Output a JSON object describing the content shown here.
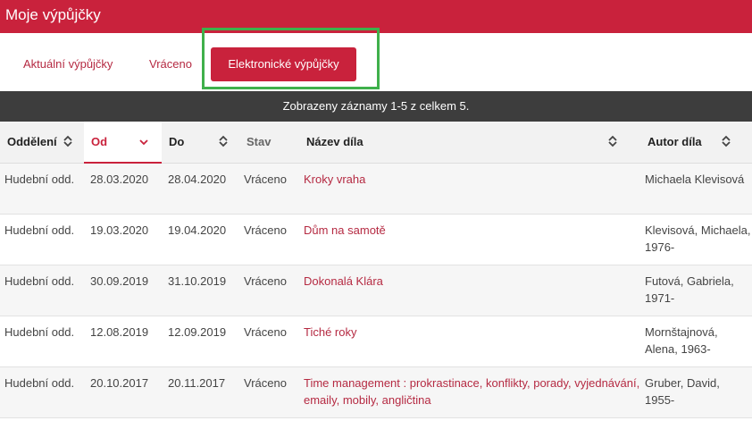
{
  "window": {
    "title": "Moje výpůjčky"
  },
  "tabs": [
    {
      "label": "Aktuální výpůjčky",
      "active": false
    },
    {
      "label": "Vráceno",
      "active": false
    },
    {
      "label": "Elektronické výpůjčky",
      "active": true
    }
  ],
  "info": "Zobrazeny záznamy 1-5 z celkem 5.",
  "colors": {
    "brand": "#c9223c",
    "infobar": "#3d3d3d",
    "highlight": "#3fb04b"
  },
  "table": {
    "headers": {
      "department": "Oddělení",
      "from": "Od",
      "to": "Do",
      "status": "Stav",
      "title": "Název díla",
      "author": "Autor díla"
    },
    "sort": {
      "column": "from",
      "direction": "desc"
    },
    "rows": [
      {
        "department": "Hudební odd.",
        "from": "28.03.2020",
        "to": "28.04.2020",
        "status": "Vráceno",
        "title": "Kroky vraha",
        "author": "Michaela Klevisová"
      },
      {
        "department": "Hudební odd.",
        "from": "19.03.2020",
        "to": "19.04.2020",
        "status": "Vráceno",
        "title": "Dům na samotě",
        "author": "Klevisová, Michaela, 1976-"
      },
      {
        "department": "Hudební odd.",
        "from": "30.09.2019",
        "to": "31.10.2019",
        "status": "Vráceno",
        "title": "Dokonalá Klára",
        "author": "Futová, Gabriela, 1971-"
      },
      {
        "department": "Hudební odd.",
        "from": "12.08.2019",
        "to": "12.09.2019",
        "status": "Vráceno",
        "title": "Tiché roky",
        "author": "Mornštajnová, Alena, 1963-"
      },
      {
        "department": "Hudební odd.",
        "from": "20.10.2017",
        "to": "20.11.2017",
        "status": "Vráceno",
        "title": "Time management : prokrastinace, konflikty, porady, vyjednávání, emaily, mobily, angličtina",
        "author": "Gruber, David, 1955-"
      }
    ]
  }
}
